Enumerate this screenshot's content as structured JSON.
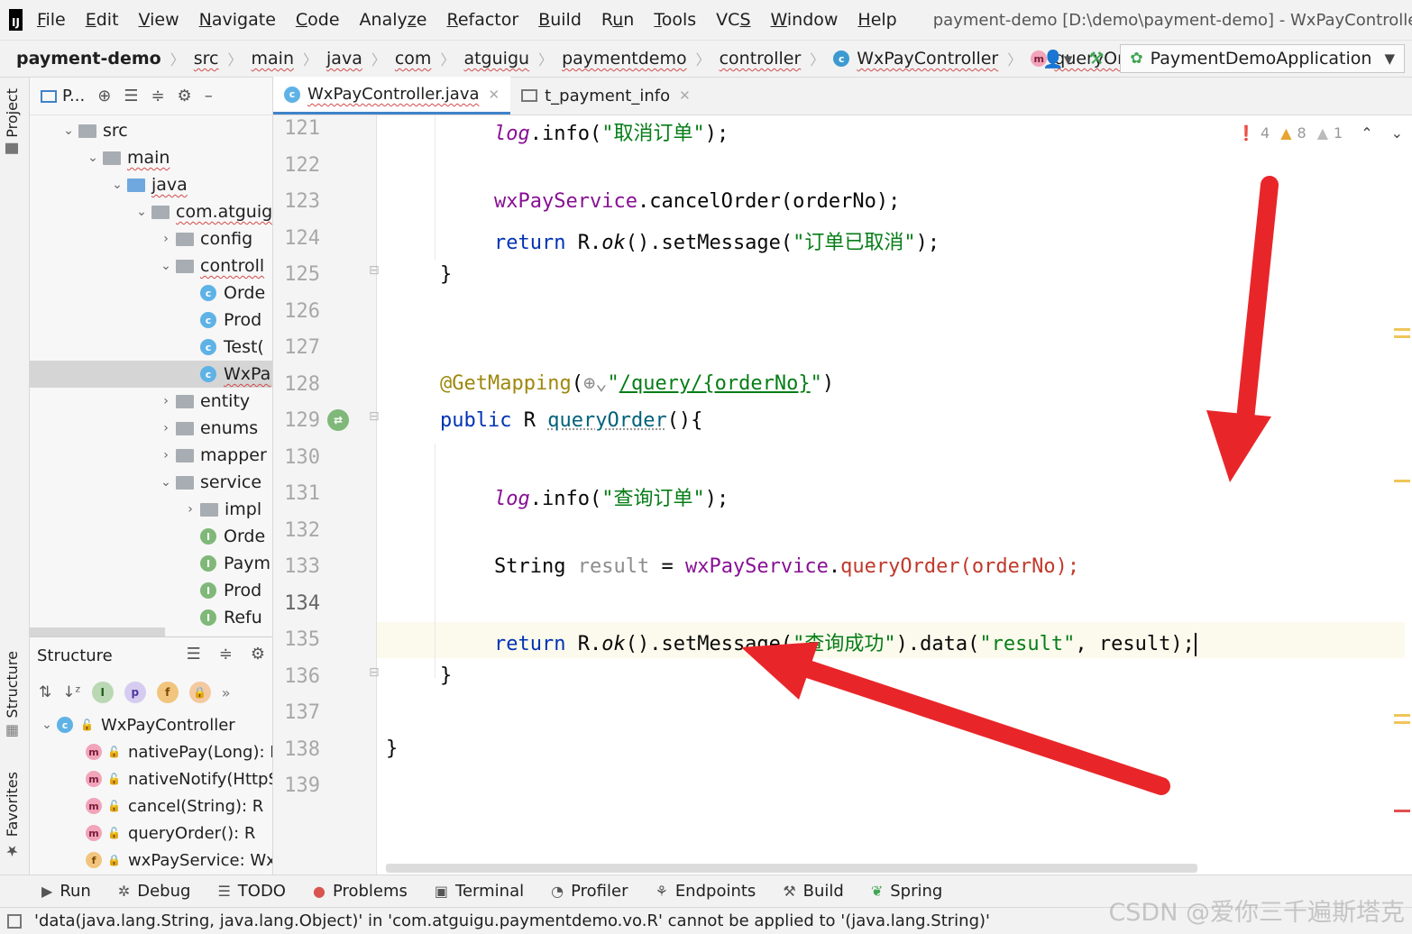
{
  "menubar": {
    "logo": "IJ",
    "items": [
      "File",
      "Edit",
      "View",
      "Navigate",
      "Code",
      "Analyze",
      "Refactor",
      "Build",
      "Run",
      "Tools",
      "VCS",
      "Window",
      "Help"
    ],
    "mnemonics": [
      "F",
      "E",
      "V",
      "N",
      "C",
      "z",
      "R",
      "B",
      "u",
      "T",
      "S",
      "W",
      "H"
    ],
    "window_title": "payment-demo [D:\\demo\\payment-demo] - WxPayController.java"
  },
  "breadcrumbs": [
    "payment-demo",
    "src",
    "main",
    "java",
    "com",
    "atguigu",
    "paymentdemo",
    "controller",
    "WxPayController",
    "queryOrder"
  ],
  "nav": {
    "run_config": "PaymentDemoApplication"
  },
  "left_strip": {
    "project": "Project",
    "structure": "Structure",
    "favorites": "Favorites"
  },
  "project": {
    "toolbar_label": "P...",
    "tree": [
      {
        "label": "src",
        "level": 1,
        "expanded": true,
        "kind": "folder"
      },
      {
        "label": "main",
        "level": 2,
        "expanded": true,
        "kind": "folder"
      },
      {
        "label": "java",
        "level": 3,
        "expanded": true,
        "kind": "folder-blue"
      },
      {
        "label": "com.atguig",
        "level": 4,
        "expanded": true,
        "kind": "package"
      },
      {
        "label": "config",
        "level": 5,
        "expanded": false,
        "kind": "package"
      },
      {
        "label": "controll",
        "level": 5,
        "expanded": true,
        "kind": "package"
      },
      {
        "label": "Orde",
        "level": 6,
        "kind": "class"
      },
      {
        "label": "Prod",
        "level": 6,
        "kind": "class"
      },
      {
        "label": "Test(",
        "level": 6,
        "kind": "class"
      },
      {
        "label": "WxPa",
        "level": 6,
        "kind": "class",
        "selected": true
      },
      {
        "label": "entity",
        "level": 5,
        "expanded": false,
        "kind": "package"
      },
      {
        "label": "enums",
        "level": 5,
        "expanded": false,
        "kind": "package"
      },
      {
        "label": "mapper",
        "level": 5,
        "expanded": false,
        "kind": "package"
      },
      {
        "label": "service",
        "level": 5,
        "expanded": true,
        "kind": "package"
      },
      {
        "label": "impl",
        "level": 6,
        "expanded": false,
        "kind": "package"
      },
      {
        "label": "Orde",
        "level": 6,
        "kind": "interface"
      },
      {
        "label": "Paym",
        "level": 6,
        "kind": "interface"
      },
      {
        "label": "Prod",
        "level": 6,
        "kind": "interface"
      },
      {
        "label": "Refu",
        "level": 6,
        "kind": "interface"
      }
    ]
  },
  "structure": {
    "title": "Structure",
    "root": "WxPayController",
    "members": [
      {
        "kind": "m",
        "label": "nativePay(Long): F"
      },
      {
        "kind": "m",
        "label": "nativeNotify(HttpS"
      },
      {
        "kind": "m",
        "label": "cancel(String): R"
      },
      {
        "kind": "m",
        "label": "queryOrder(): R"
      },
      {
        "kind": "f",
        "label": "wxPayService: Wx"
      }
    ]
  },
  "tabs": [
    {
      "label": "WxPayController.java",
      "active": true
    },
    {
      "label": "t_payment_info",
      "active": false
    }
  ],
  "inspections": {
    "errors": "4",
    "warnings": "8",
    "weak": "1"
  },
  "editor": {
    "line_numbers": [
      "121",
      "122",
      "123",
      "124",
      "125",
      "126",
      "127",
      "128",
      "129",
      "130",
      "131",
      "132",
      "133",
      "134",
      "135",
      "136",
      "137",
      "138",
      "139"
    ],
    "current_line": "134",
    "code": {
      "l121": {
        "a": "log",
        "b": ".info(",
        "c": "\"取消订单\"",
        "d": ");"
      },
      "l123": {
        "a": "wxPayService",
        "b": ".cancelOrder(orderNo);"
      },
      "l124": {
        "a": "return",
        "b": " R.",
        "c": "ok",
        "d": "().setMessage(",
        "e": "\"订单已取消\"",
        "f": ");"
      },
      "l125": {
        "a": "}"
      },
      "l128": {
        "a": "@GetMapping",
        "b": "(",
        "c": "\"",
        "d": "/query/{orderNo}",
        "e": "\"",
        "f": ")"
      },
      "l129": {
        "a": "public",
        "b": " R ",
        "c": "queryOrder",
        "d": "(){"
      },
      "l131": {
        "a": "log",
        "b": ".info(",
        "c": "\"查询订单\"",
        "d": ");"
      },
      "l133": {
        "a": "String ",
        "b": "result",
        "c": " = ",
        "d": "wxPayService",
        "e": ".",
        "f": "queryOrder",
        "g": "(orderNo);"
      },
      "l134": {
        "a": "return",
        "b": " R.",
        "c": "ok",
        "d": "().setMessage(",
        "e": "\"查询成功\"",
        "f": ").data(",
        "g": "\"result\"",
        "h": ", result);"
      },
      "l136": {
        "a": "}"
      },
      "l138": {
        "a": "}"
      }
    }
  },
  "bottom_tools": [
    "Run",
    "Debug",
    "TODO",
    "Problems",
    "Terminal",
    "Profiler",
    "Endpoints",
    "Build",
    "Spring"
  ],
  "status": {
    "message": "'data(java.lang.String, java.lang.Object)' in 'com.atguigu.paymentdemo.vo.R' cannot be applied to '(java.lang.String)'"
  },
  "watermark": "CSDN @爱你三千遍斯塔克",
  "colors": {
    "annotation_arrow": "#e8262a",
    "accent": "#4083c9",
    "keyword": "#0033b3",
    "string": "#067d17"
  }
}
